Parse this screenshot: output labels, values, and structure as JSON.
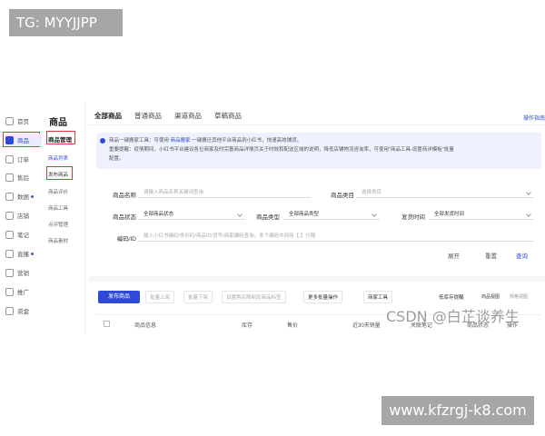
{
  "watermarks": {
    "top": "TG: MYYJJPP",
    "bottom": "www.kfzrgj-k8.com",
    "csdn": "CSDN @白芷谈养生"
  },
  "left_nav": {
    "items": [
      {
        "label": "首页",
        "icon": "home-icon"
      },
      {
        "label": "商品",
        "icon": "goods-icon",
        "active": true
      },
      {
        "label": "订单",
        "icon": "order-icon"
      },
      {
        "label": "售后",
        "icon": "after-sale-icon"
      },
      {
        "label": "数据",
        "icon": "data-icon",
        "dot": true
      },
      {
        "label": "店铺",
        "icon": "shop-icon"
      },
      {
        "label": "笔记",
        "icon": "note-icon"
      },
      {
        "label": "直播",
        "icon": "live-icon",
        "dot": true
      },
      {
        "label": "营销",
        "icon": "marketing-icon"
      },
      {
        "label": "推广",
        "icon": "promotion-icon"
      },
      {
        "label": "资金",
        "icon": "funds-icon"
      }
    ]
  },
  "sub_nav": {
    "title": "商品",
    "items": [
      "商品管理",
      "商品列表",
      "发布商品",
      "商品评价",
      "商品工具",
      "点评管理",
      "商品素材"
    ]
  },
  "tabs": [
    "全部商品",
    "普通商品",
    "渠道商品",
    "草稿商品"
  ],
  "help_link": "操作指南",
  "notice": {
    "line1_prefix": "商品一键搬家工具：可使用",
    "line1_link": "商品搬家",
    "line1_suffix": "一键搬迁其他平台商品到小红书，快速高效铺货。",
    "line2": "重要提醒：疫情期间，小红书平台建议各位商家及时完善商品详情页关于时效和配送区域的说明，降低店铺物流咨询率，可使用\"商品工具-设置商详模板\"批量",
    "line3": "配置。"
  },
  "form": {
    "name_label": "商品名称",
    "name_placeholder": "请输入商品名称关键词查询",
    "category_label": "商品类目",
    "category_placeholder": "选择类目",
    "status_label": "商品状态",
    "status_value": "全部商品状态",
    "type_label": "商品类型",
    "type_value": "全部商品类型",
    "ship_label": "发货时间",
    "ship_value": "全部发货时间",
    "code_label": "编码/ID",
    "code_placeholder": "输入小红书编码/条形码/商品ID/货号/商家编码查询，多个编码中间用【,】分隔",
    "expand": "展开",
    "reset": "重置",
    "search": "查询"
  },
  "toolbar": {
    "publish": "发布商品",
    "batch_on": "批量上架",
    "batch_off": "批量下架",
    "set_restrict": "设置购买限制及商品标签",
    "more_batch": "更多批量操作",
    "merchant_tools": "商家工具",
    "stock_alert": "低库存提醒",
    "view_goods": "商品视图",
    "view_sku": "规格视图"
  },
  "table_headers": [
    "商品信息",
    "库存",
    "售价",
    "近30天销量",
    "关联笔记",
    "商品状态",
    "操作"
  ]
}
